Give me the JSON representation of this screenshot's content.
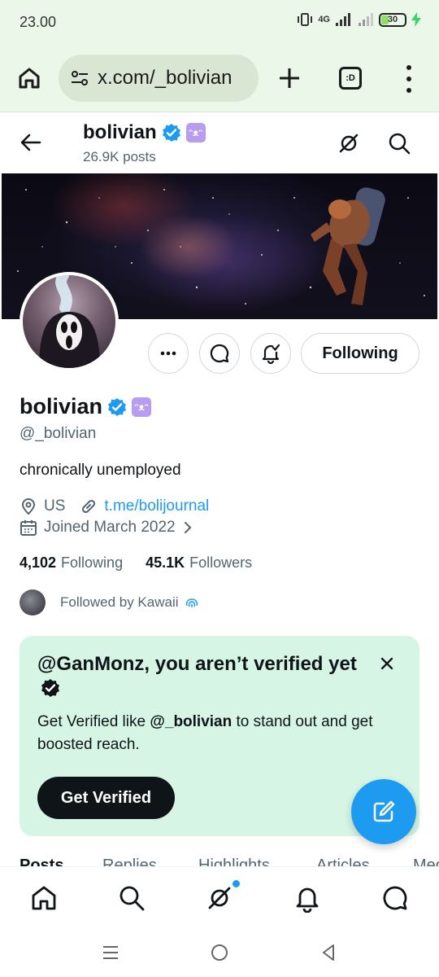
{
  "status_bar": {
    "time": "23.00",
    "network": "4G",
    "battery": "30",
    "battery_level": 0.3
  },
  "browser": {
    "url": "x.com/_bolivian",
    "tabs_label": ":D"
  },
  "header": {
    "name": "bolivian",
    "posts": "26.9K posts"
  },
  "profile": {
    "display_name": "bolivian",
    "handle": "@_bolivian",
    "bio": "chronically unemployed",
    "location": "US",
    "link": "t.me/bolijournal",
    "joined": "Joined March 2022",
    "following_count": "4,102",
    "following_label": "Following",
    "followers_count": "45.1K",
    "followers_label": "Followers",
    "followed_by": "Followed by Kawaii"
  },
  "actions": {
    "following_button": "Following"
  },
  "verify_card": {
    "title": "@GanMonz, you aren’t verified yet",
    "body_prefix": "Get Verified like ",
    "body_handle": "@_bolivian",
    "body_suffix": " to stand out and get boosted reach.",
    "button": "Get Verified"
  },
  "tabs": [
    "Posts",
    "Replies",
    "Highlights",
    "Articles",
    "Media"
  ],
  "colors": {
    "accent": "#1d9bf0",
    "card_bg": "#d6f5e4",
    "browser_bg": "#ebf7e8",
    "affiliate_badge": "#b89cf0"
  },
  "icons": {
    "bottom_nav": [
      "home-icon",
      "search-icon",
      "grok-icon",
      "bell-icon",
      "messages-icon"
    ],
    "system_nav": [
      "recents-icon",
      "home-circle-icon",
      "back-triangle-icon"
    ]
  }
}
